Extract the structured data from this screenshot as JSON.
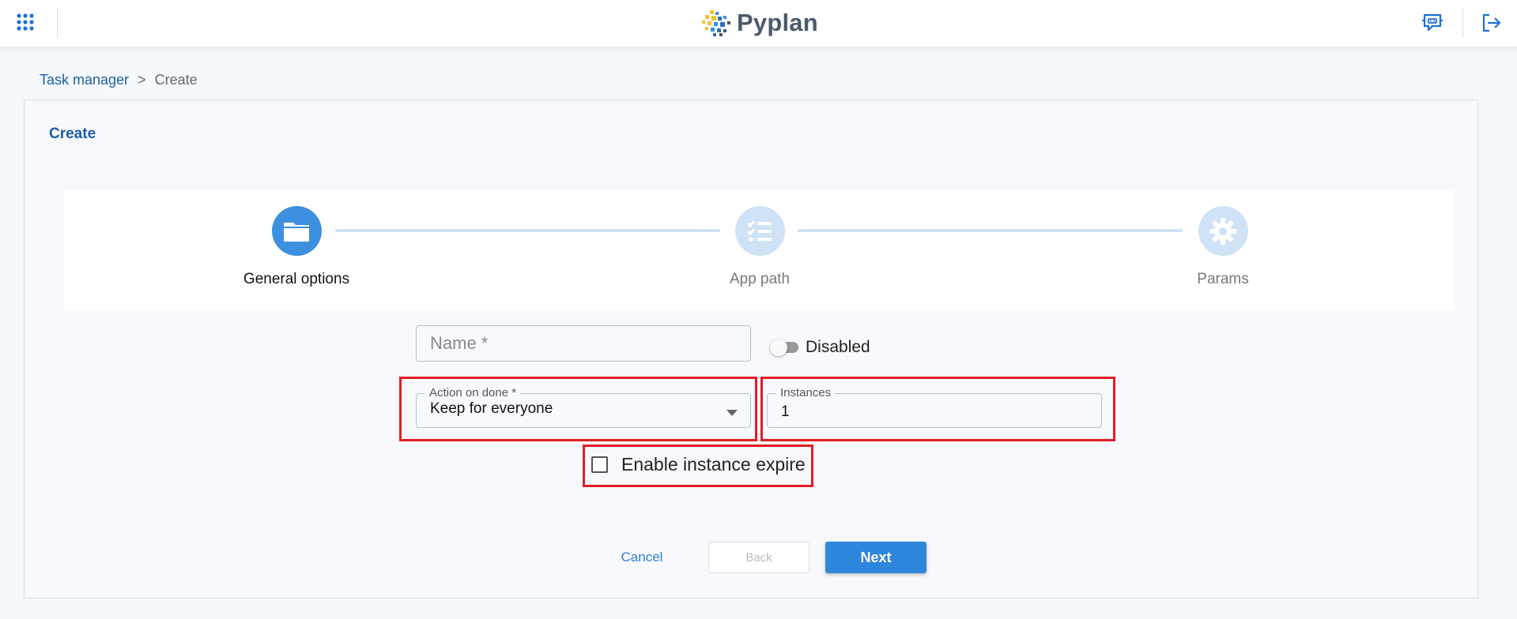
{
  "header": {
    "logo_text": "Pyplan",
    "apps_icon": "grid-apps-icon",
    "chat_icon": "chat-bubble-icon",
    "logout_icon": "logout-icon",
    "accent_color": "#1e6fd9"
  },
  "breadcrumb": {
    "parent": "Task manager",
    "separator": ">",
    "current": "Create"
  },
  "card": {
    "title": "Create"
  },
  "stepper": {
    "steps": [
      {
        "label": "General options",
        "icon": "folder-icon",
        "state": "active"
      },
      {
        "label": "App path",
        "icon": "checklist-icon",
        "state": "inactive"
      },
      {
        "label": "Params",
        "icon": "gear-icon",
        "state": "inactive"
      }
    ]
  },
  "form": {
    "name_placeholder": "Name *",
    "name_value": "",
    "enabled_toggle_label": "Disabled",
    "action_on_done_label": "Action on done *",
    "action_on_done_value": "Keep for everyone",
    "instances_label": "Instances",
    "instances_value": "1",
    "enable_instance_expire_label": "Enable instance expire",
    "enable_instance_expire_checked": false
  },
  "buttons": {
    "cancel": "Cancel",
    "back": "Back",
    "next": "Next"
  }
}
